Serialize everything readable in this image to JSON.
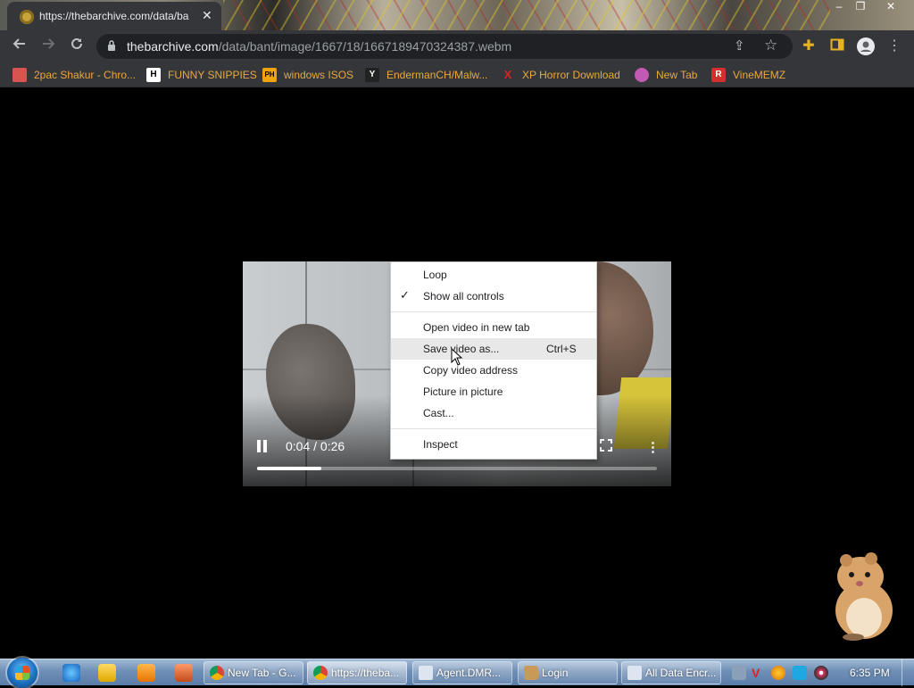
{
  "browser": {
    "tab": {
      "title": "https://thebarchive.com/data/ba"
    },
    "window_controls": {
      "minimize": "–",
      "maximize": "❐",
      "close": "✕"
    },
    "address": {
      "host": "thebarchive.com",
      "path": "/data/bant/image/1667/18/1667189470324387.webm"
    },
    "icons": {
      "back": "arrow-left-icon",
      "forward": "arrow-right-icon",
      "reload": "reload-icon",
      "lock": "lock-icon",
      "share": "share-icon",
      "star": "star-icon",
      "extensions": "puzzle-icon",
      "sidepanel": "sidepanel-icon",
      "profile": "profile-icon",
      "menu": "kebab-menu-icon"
    },
    "bookmarks": [
      {
        "label": "2pac Shakur - Chro...",
        "icon_color": "#d9534f",
        "icon_text": ""
      },
      {
        "label": "FUNNY SNIPPIES",
        "icon_color": "#ffffff",
        "icon_text": "H"
      },
      {
        "label": "windows ISOS",
        "icon_color": "#f0a30a",
        "icon_text": "PH"
      },
      {
        "label": "EndermanCH/Malw...",
        "icon_color": "#222222",
        "icon_text": "Y"
      },
      {
        "label": "XP Horror Download",
        "icon_color": "#e02020",
        "icon_text": "X"
      },
      {
        "label": "New Tab",
        "icon_color": "#c25ab4",
        "icon_text": ""
      },
      {
        "label": "VineMEMZ",
        "icon_color": "#d32f2f",
        "icon_text": "R"
      }
    ]
  },
  "video": {
    "time": "0:04 / 0:26",
    "progress": 0.16,
    "playing": true
  },
  "context_menu": {
    "items": [
      {
        "label": "Loop",
        "checked": false,
        "shortcut": ""
      },
      {
        "label": "Show all controls",
        "checked": true,
        "shortcut": ""
      },
      {
        "label": "Open video in new tab",
        "checked": false,
        "shortcut": ""
      },
      {
        "label": "Save video as...",
        "checked": false,
        "shortcut": "Ctrl+S",
        "highlighted": true
      },
      {
        "label": "Copy video address",
        "checked": false,
        "shortcut": ""
      },
      {
        "label": "Picture in picture",
        "checked": false,
        "shortcut": ""
      },
      {
        "label": "Cast...",
        "checked": false,
        "shortcut": ""
      },
      {
        "label": "Inspect",
        "checked": false,
        "shortcut": ""
      }
    ],
    "check_mark": "✓"
  },
  "taskbar": {
    "buttons": [
      {
        "label": "New Tab - G...",
        "icon": "chrome-icon",
        "active": false
      },
      {
        "label": "https://theba...",
        "icon": "chrome-icon",
        "active": true
      },
      {
        "label": "Agent.DMR...",
        "icon": "window-icon",
        "active": false
      },
      {
        "label": "Login",
        "icon": "app-icon",
        "active": false
      },
      {
        "label": "All Data Encr...",
        "icon": "window-icon",
        "active": false
      }
    ],
    "clock": "6:35 PM"
  },
  "colors": {
    "chrome_dark": "#35363a",
    "bookmark_text": "#e8a93b",
    "menu_highlight": "#e8e8e8"
  }
}
